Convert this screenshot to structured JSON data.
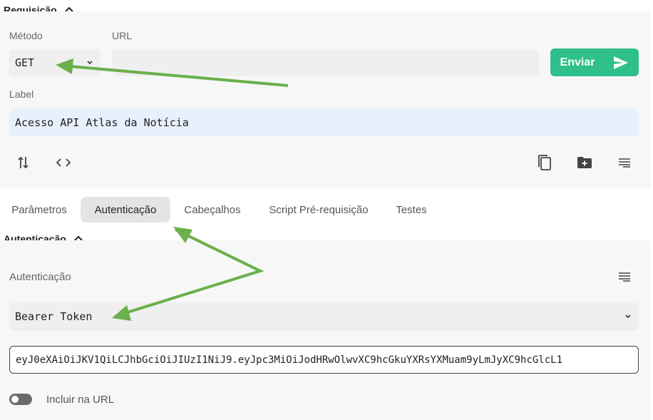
{
  "request": {
    "section_title": "Requisição",
    "method_label": "Método",
    "method_value": "GET",
    "url_label": "URL",
    "url_value": "",
    "send_label": "Enviar",
    "label_label": "Label",
    "label_value": "Acesso API Atlas da Notícia"
  },
  "tabs": [
    {
      "label": "Parâmetros",
      "active": false
    },
    {
      "label": "Autenticação",
      "active": true
    },
    {
      "label": "Cabeçalhos",
      "active": false
    },
    {
      "label": "Script Pré-requisição",
      "active": false
    },
    {
      "label": "Testes",
      "active": false
    }
  ],
  "auth": {
    "section_title": "Autenticação",
    "type_label": "Autenticação",
    "type_value": "Bearer Token",
    "token_value": "eyJ0eXAiOiJKV1QiLCJhbGciOiJIUzI1NiJ9.eyJpc3MiOiJodHRwOlwvXC9hcGkuYXRsYXMuam9yLmJyXC9hcGlcL1",
    "include_in_url_label": "Incluir na URL",
    "include_in_url": false
  },
  "colors": {
    "send_button": "#2fbf8a",
    "annotation_arrow": "#6ab04c",
    "label_field_bg": "#e8f0fe"
  },
  "icons": {
    "collapse": "chevron-up-icon",
    "method_dropdown": "chevron-down-icon",
    "send": "send-icon",
    "sort": "sort-arrows-icon",
    "code": "code-icon",
    "copy": "copy-icon",
    "new_folder": "folder-plus-icon",
    "format": "format-lines-icon"
  }
}
